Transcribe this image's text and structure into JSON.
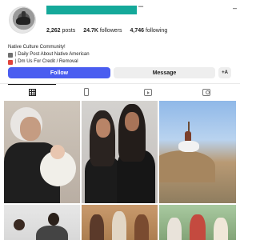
{
  "header": {
    "more_glyph": "–",
    "username_redacted": true,
    "username_bar_color": "#15a99a"
  },
  "stats": {
    "posts_value": "2,262",
    "posts_label": "posts",
    "followers_value": "24.7K",
    "followers_label": "followers",
    "following_value": "4,746",
    "following_label": "following"
  },
  "bio": {
    "lines": [
      "Native Culture Community!",
      "| Daily Post About Native American",
      "| Dm Us For Credit / Removal"
    ]
  },
  "actions": {
    "follow_label": "Follow",
    "message_label": "Message",
    "suggest_label": "+A",
    "follow_color": "#4a5df0"
  },
  "tabs": [
    {
      "name": "posts-grid",
      "icon": "grid-icon",
      "active": true
    },
    {
      "name": "reels",
      "icon": "phone-icon",
      "active": false
    },
    {
      "name": "videos",
      "icon": "clapper-icon",
      "active": false
    },
    {
      "name": "tagged",
      "icon": "person-tag-icon",
      "active": false
    }
  ],
  "posts": [
    {
      "icon": "photo-elder-with-baby"
    },
    {
      "icon": "photo-two-young-people"
    },
    {
      "icon": "photo-rider-on-horse"
    },
    {
      "icon": "photo-couple"
    },
    {
      "icon": "photo-group-regalia"
    },
    {
      "icon": "photo-children-outdoors"
    }
  ]
}
